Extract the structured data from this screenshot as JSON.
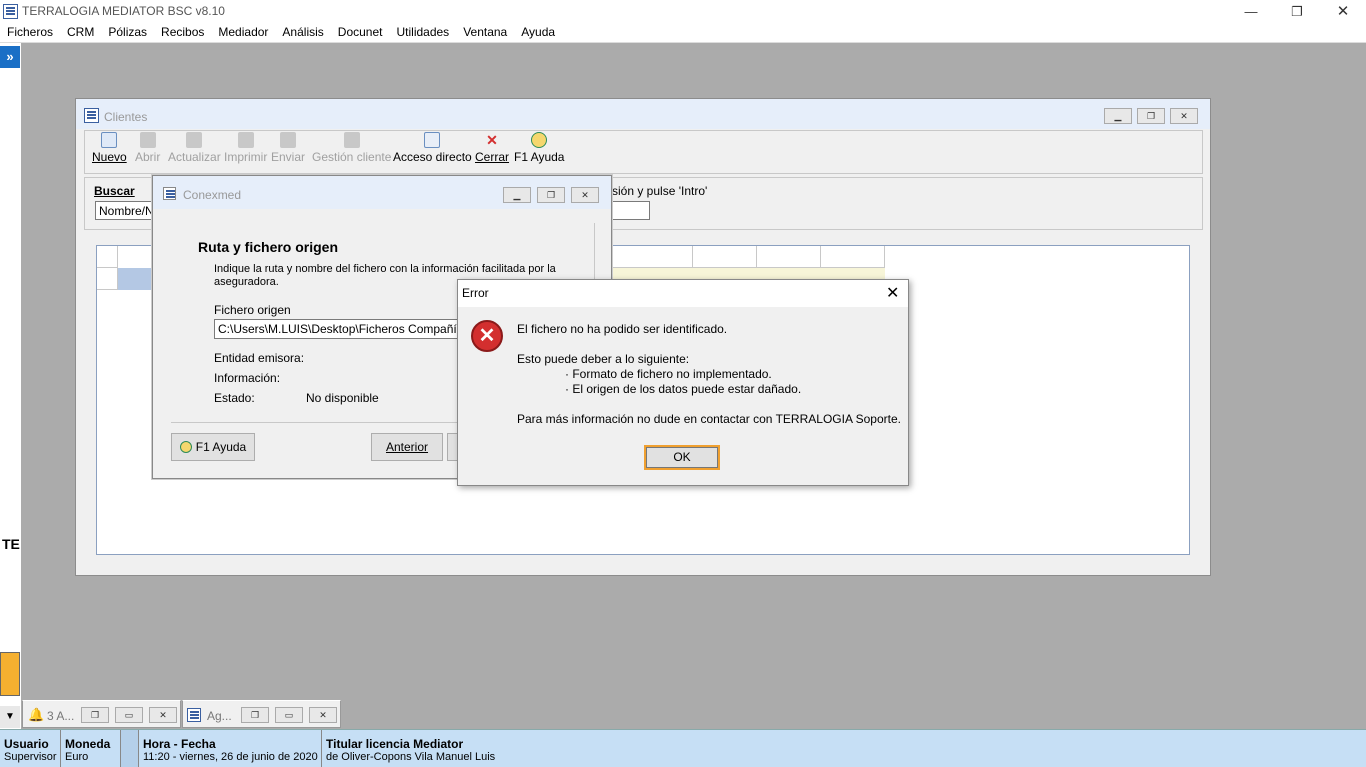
{
  "app": {
    "title": "TERRALOGIA MEDIATOR BSC v8.10"
  },
  "menu": [
    "Ficheros",
    "CRM",
    "Pólizas",
    "Recibos",
    "Mediador",
    "Análisis",
    "Docunet",
    "Utilidades",
    "Ventana",
    "Ayuda"
  ],
  "sidebar": {
    "expand_glyph": "»",
    "label": "TE"
  },
  "clientes": {
    "title": "Clientes",
    "toolbar": [
      {
        "label": "Nuevo",
        "enabled": true,
        "icon": "new-doc-icon"
      },
      {
        "label": "Abrir",
        "enabled": false,
        "icon": "open-doc-icon"
      },
      {
        "label": "Actualizar",
        "enabled": false,
        "icon": "update-doc-icon"
      },
      {
        "label": "Imprimir",
        "enabled": false,
        "icon": "printer-icon"
      },
      {
        "label": "Enviar",
        "enabled": false,
        "icon": "send-icon"
      },
      {
        "label": "Gestión cliente",
        "enabled": false,
        "icon": "client-icon"
      },
      {
        "label": "Acceso directo",
        "enabled": true,
        "icon": "shortcut-icon"
      },
      {
        "label": "Cerrar",
        "enabled": true,
        "icon": "close-red-icon"
      },
      {
        "label": "F1 Ayuda",
        "enabled": true,
        "icon": "help-icon"
      }
    ],
    "search_label": "Buscar",
    "search_combo": "Nombre/Nif",
    "search_hint": "sión y pulse 'Intro'"
  },
  "conexmed": {
    "title": "Conexmed",
    "heading": "Ruta y fichero origen",
    "description": "Indique la ruta y nombre del fichero con la información facilitada por la aseguradora.",
    "file_label": "Fichero origen",
    "file_value": "C:\\Users\\M.LUIS\\Desktop\\Ficheros Compañías\\F",
    "entidad_label": "Entidad emisora:",
    "info_label": "Información:",
    "estado_label": "Estado:",
    "estado_value": "No disponible",
    "help_button": "F1 Ayuda",
    "prev_button": "Anterior"
  },
  "error": {
    "title": "Error",
    "line1": "El fichero no ha podido ser identificado.",
    "line2": "Esto puede deber a lo siguiente:",
    "bullet1": "· Formato de fichero no implementado.",
    "bullet2": "· El origen de los datos puede estar dañado.",
    "line3": "Para más información no dude en contactar con TERRALOGIA Soporte.",
    "ok": "OK"
  },
  "minimized": [
    {
      "label": "3 A..."
    },
    {
      "label": "Ag..."
    }
  ],
  "status": {
    "usuario_h": "Usuario",
    "usuario_v": "Supervisor",
    "moneda_h": "Moneda",
    "moneda_v": "Euro",
    "hora_h": "Hora - Fecha",
    "hora_v": "11:20 - viernes, 26 de junio de 2020",
    "titular_h": "Titular licencia Mediator",
    "titular_v": "de Oliver-Copons Vila Manuel Luis"
  },
  "colors": {
    "accent": "#1a6fc6",
    "status_bg": "#c6dff5",
    "mdi_bg": "#ababab",
    "error_icon": "#d32f2f"
  }
}
